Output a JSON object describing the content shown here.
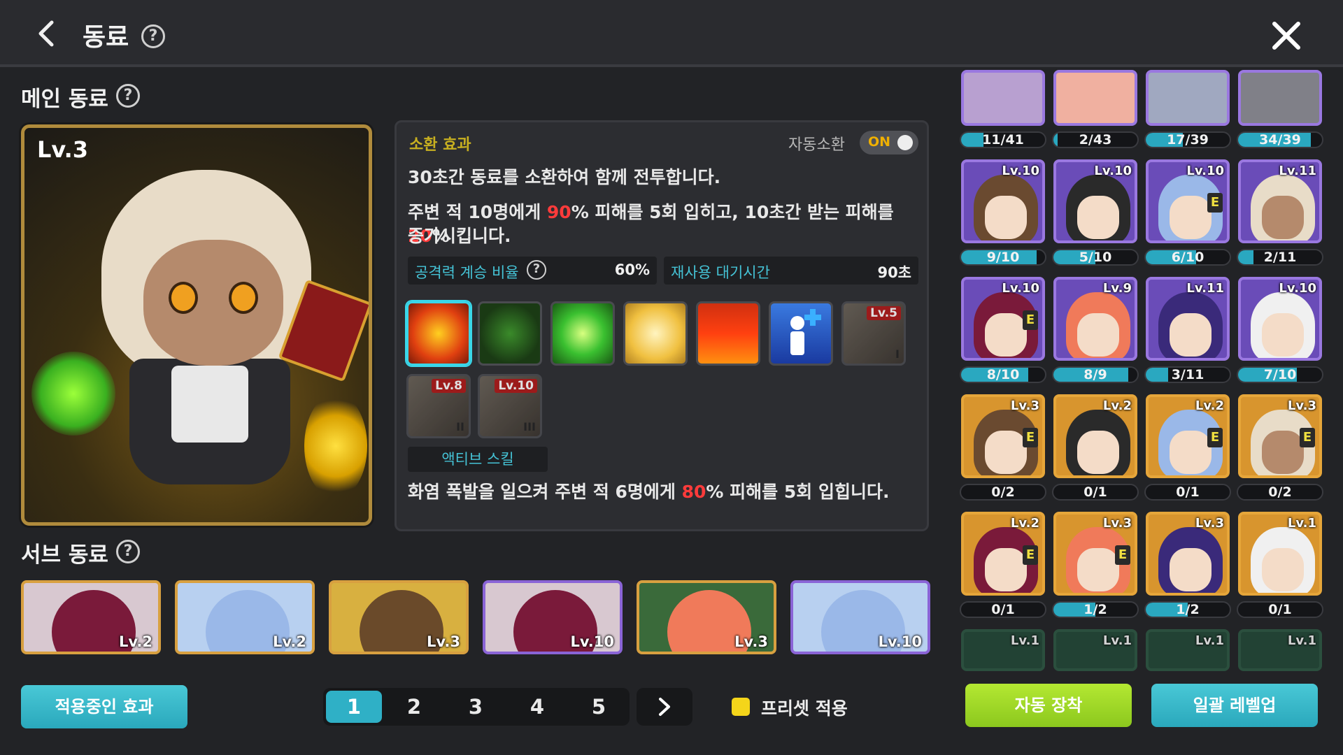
{
  "header": {
    "title": "동료",
    "help": "?"
  },
  "main_section": {
    "title": "메인 동료",
    "help": "?",
    "level": "Lv.3"
  },
  "skill_panel": {
    "summon_label": "소환 효과",
    "auto_summon_label": "자동소환",
    "auto_summon_state": "ON",
    "desc1": "30초간 동료를 소환하여 함께 전투합니다.",
    "desc2_a": "주변 적 10명에게 ",
    "desc2_b": "90",
    "desc2_c": "% 피해를 5회 입히고, 10초간 받는 피해를 ",
    "desc2_d": "20",
    "desc2_e": "%",
    "desc3": "증가시킵니다.",
    "stat1_label": "공격력 계승 비율",
    "stat1_value": "60%",
    "stat2_label": "재사용 대기시간",
    "stat2_value": "90초",
    "skills": [
      {
        "icon": "fire-seal-icon",
        "level": ""
      },
      {
        "icon": "green-leaf-icon",
        "level": ""
      },
      {
        "icon": "green-burst-icon",
        "level": ""
      },
      {
        "icon": "golden-figure-icon",
        "level": ""
      },
      {
        "icon": "flame-icon",
        "level": ""
      },
      {
        "icon": "person-plus-icon",
        "level": ""
      },
      {
        "icon": "locked-skill-icon",
        "level": "Lv.5",
        "roman": "I"
      },
      {
        "icon": "locked-skill-icon",
        "level": "Lv.8",
        "roman": "II"
      },
      {
        "icon": "locked-skill-icon",
        "level": "Lv.10",
        "roman": "III"
      }
    ],
    "active_tag": "액티브 스킬",
    "active_desc_a": "화염 폭발을 일으켜 주변 적 6명에게 ",
    "active_desc_b": "80",
    "active_desc_c": "% 피해를 5회 입힙니다."
  },
  "sub_section": {
    "title": "서브 동료",
    "help": "?",
    "cards": [
      {
        "level": "Lv.2"
      },
      {
        "level": "Lv.2"
      },
      {
        "level": "Lv.3"
      },
      {
        "level": "Lv.10"
      },
      {
        "level": "Lv.3"
      },
      {
        "level": "Lv.10"
      }
    ]
  },
  "bottom": {
    "applied_effects": "적용중인 효과",
    "pages": [
      "1",
      "2",
      "3",
      "4",
      "5"
    ],
    "current_page": 1,
    "next": "›",
    "preset_label": "프리셋 적용",
    "auto_equip": "자동 장착",
    "bulk_levelup": "일괄 레벨업"
  },
  "collection": {
    "row0": [
      {
        "progress": "11/41",
        "fill": 0.27
      },
      {
        "progress": "2/43",
        "fill": 0.05
      },
      {
        "progress": "17/39",
        "fill": 0.44
      },
      {
        "progress": "34/39",
        "fill": 0.87
      }
    ],
    "row1": [
      {
        "level": "Lv.10",
        "progress": "9/10",
        "fill": 0.9,
        "e": false
      },
      {
        "level": "Lv.10",
        "progress": "5/10",
        "fill": 0.5,
        "e": false
      },
      {
        "level": "Lv.10",
        "progress": "6/10",
        "fill": 0.6,
        "e": true
      },
      {
        "level": "Lv.11",
        "progress": "2/11",
        "fill": 0.18,
        "e": false
      }
    ],
    "row2": [
      {
        "level": "Lv.10",
        "progress": "8/10",
        "fill": 0.8,
        "e": true
      },
      {
        "level": "Lv.9",
        "progress": "8/9",
        "fill": 0.89,
        "e": false
      },
      {
        "level": "Lv.11",
        "progress": "3/11",
        "fill": 0.27,
        "e": false
      },
      {
        "level": "Lv.10",
        "progress": "7/10",
        "fill": 0.7,
        "e": false
      }
    ],
    "row3": [
      {
        "level": "Lv.3",
        "progress": "0/2",
        "fill": 0,
        "e": true
      },
      {
        "level": "Lv.2",
        "progress": "0/1",
        "fill": 0,
        "e": false
      },
      {
        "level": "Lv.2",
        "progress": "0/1",
        "fill": 0,
        "e": true
      },
      {
        "level": "Lv.3",
        "progress": "0/2",
        "fill": 0,
        "e": true
      }
    ],
    "row4": [
      {
        "level": "Lv.2",
        "progress": "0/1",
        "fill": 0,
        "e": true
      },
      {
        "level": "Lv.3",
        "progress": "1/2",
        "fill": 0.5,
        "e": true
      },
      {
        "level": "Lv.3",
        "progress": "1/2",
        "fill": 0.5,
        "e": false
      },
      {
        "level": "Lv.1",
        "progress": "0/1",
        "fill": 0,
        "e": false
      }
    ],
    "row5": [
      {
        "level": "Lv.1"
      },
      {
        "level": "Lv.1"
      },
      {
        "level": "Lv.1"
      },
      {
        "level": "Lv.1"
      }
    ]
  },
  "colors": {
    "accent_cyan": "#2fb0c6",
    "accent_green": "#9cd82a",
    "epic_purple": "#9a78e0",
    "unique_gold": "#e6a63a",
    "damage_red": "#ff3b3b"
  }
}
